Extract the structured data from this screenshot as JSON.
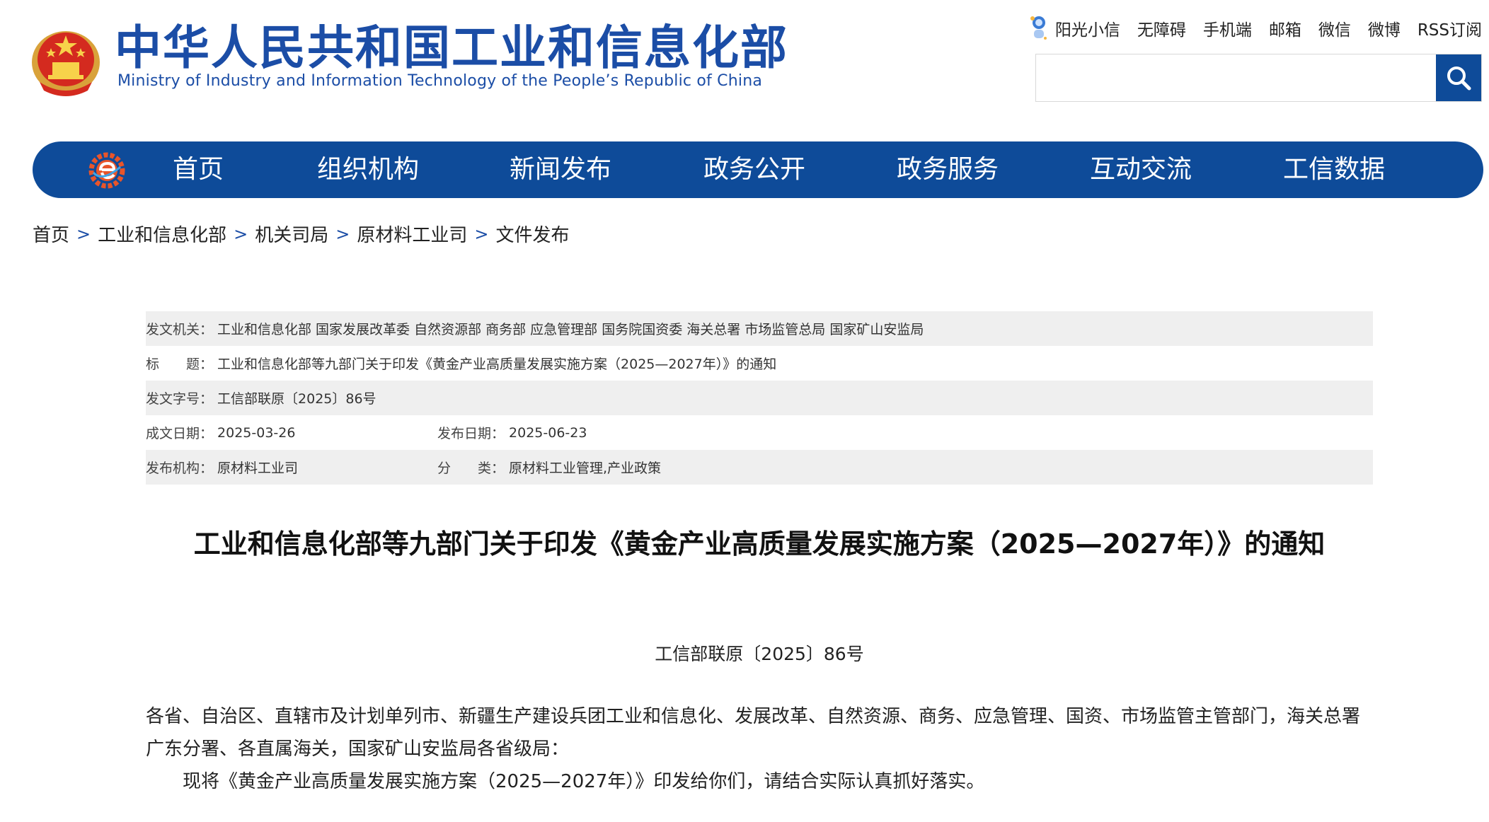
{
  "site": {
    "title": "中华人民共和国工业和信息化部",
    "subtitle": "Ministry of Industry and Information Technology of the People’s Republic of China"
  },
  "toplinks": [
    {
      "label": "阳光小信",
      "icon": "robot-mascot-icon"
    },
    {
      "label": "无障碍"
    },
    {
      "label": "手机端"
    },
    {
      "label": "邮箱"
    },
    {
      "label": "微信"
    },
    {
      "label": "微博"
    },
    {
      "label": "RSS订阅"
    }
  ],
  "search": {
    "placeholder": "",
    "icon": "search-icon"
  },
  "nav": {
    "logo_icon": "e-gear-logo-icon",
    "items": [
      "首页",
      "组织机构",
      "新闻发布",
      "政务公开",
      "政务服务",
      "互动交流",
      "工信数据"
    ]
  },
  "breadcrumb": [
    "首页",
    "工业和信息化部",
    "机关司局",
    "原材料工业司",
    "文件发布"
  ],
  "meta": {
    "issuer_label": "发文机关：",
    "issuer": "工业和信息化部 国家发展改革委 自然资源部 商务部 应急管理部 国务院国资委 海关总署 市场监管总局 国家矿山安监局",
    "title_label": "标　　题：",
    "title": "工业和信息化部等九部门关于印发《黄金产业高质量发展实施方案（2025—2027年）》的通知",
    "docno_label": "发文字号：",
    "docno": "工信部联原〔2025〕86号",
    "date_label": "成文日期：",
    "date": "2025-03-26",
    "pubdate_label": "发布日期：",
    "pubdate": "2025-06-23",
    "org_label": "发布机构：",
    "org": "原材料工业司",
    "category_label": "分　　类：",
    "category": "原材料工业管理,产业政策"
  },
  "article": {
    "title": "工业和信息化部等九部门关于印发《黄金产业高质量发展实施方案（2025—2027年）》的通知",
    "number": "工信部联原〔2025〕86号",
    "para1": "各省、自治区、直辖市及计划单列市、新疆生产建设兵团工业和信息化、发展改革、自然资源、商务、应急管理、国资、市场监管主管部门，海关总署广东分署、各直属海关，国家矿山安监局各省级局：",
    "para2": "现将《黄金产业高质量发展实施方案（2025—2027年）》印发给你们，请结合实际认真抓好落实。"
  },
  "colors": {
    "brand_blue": "#0e4b99",
    "title_blue": "#1b4da6",
    "meta_shade": "#efefef"
  }
}
